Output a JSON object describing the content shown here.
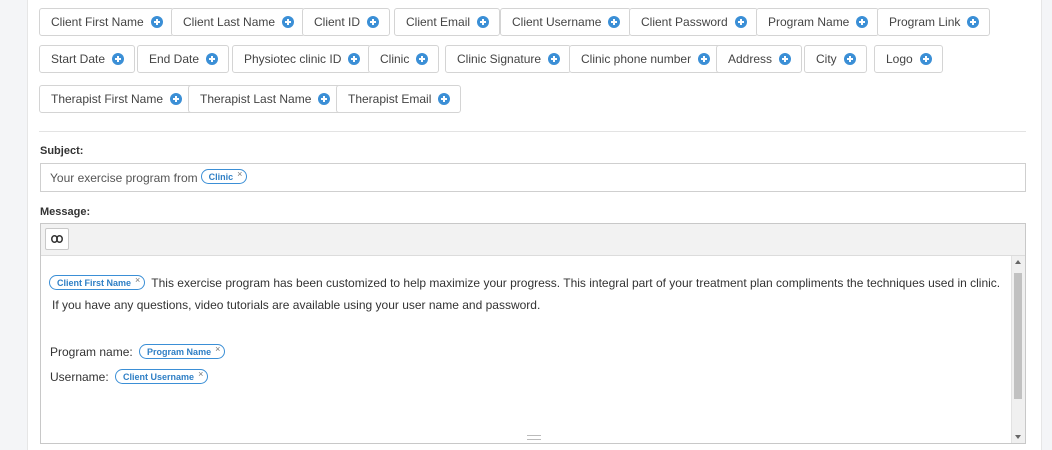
{
  "placeholders": [
    "Client First Name",
    "Client Last Name",
    "Client ID",
    "Client Email",
    "Client Username",
    "Client Password",
    "Program Name",
    "Program Link",
    "Start Date",
    "End Date",
    "Physiotec clinic ID",
    "Clinic",
    "Clinic Signature",
    "Clinic phone number",
    "Address",
    "City",
    "Logo",
    "Therapist First Name",
    "Therapist Last Name",
    "Therapist Email"
  ],
  "subject": {
    "label": "Subject:",
    "text": "Your exercise program from",
    "chip": "Clinic"
  },
  "message": {
    "label": "Message:",
    "line1_chip": "Client First Name",
    "line1_text": "This exercise program has been customized to help maximize your progress. This integral part of your treatment plan compliments the techniques used in clinic.",
    "line2_text": "If you have any questions, video tutorials are available using your user name and password.",
    "program_label": "Program name:",
    "program_chip": "Program Name",
    "username_label": "Username:",
    "username_chip": "Client Username"
  },
  "chip_remove": "×",
  "colors": {
    "accent": "#3b8fd6",
    "border": "#d4d4d4"
  }
}
